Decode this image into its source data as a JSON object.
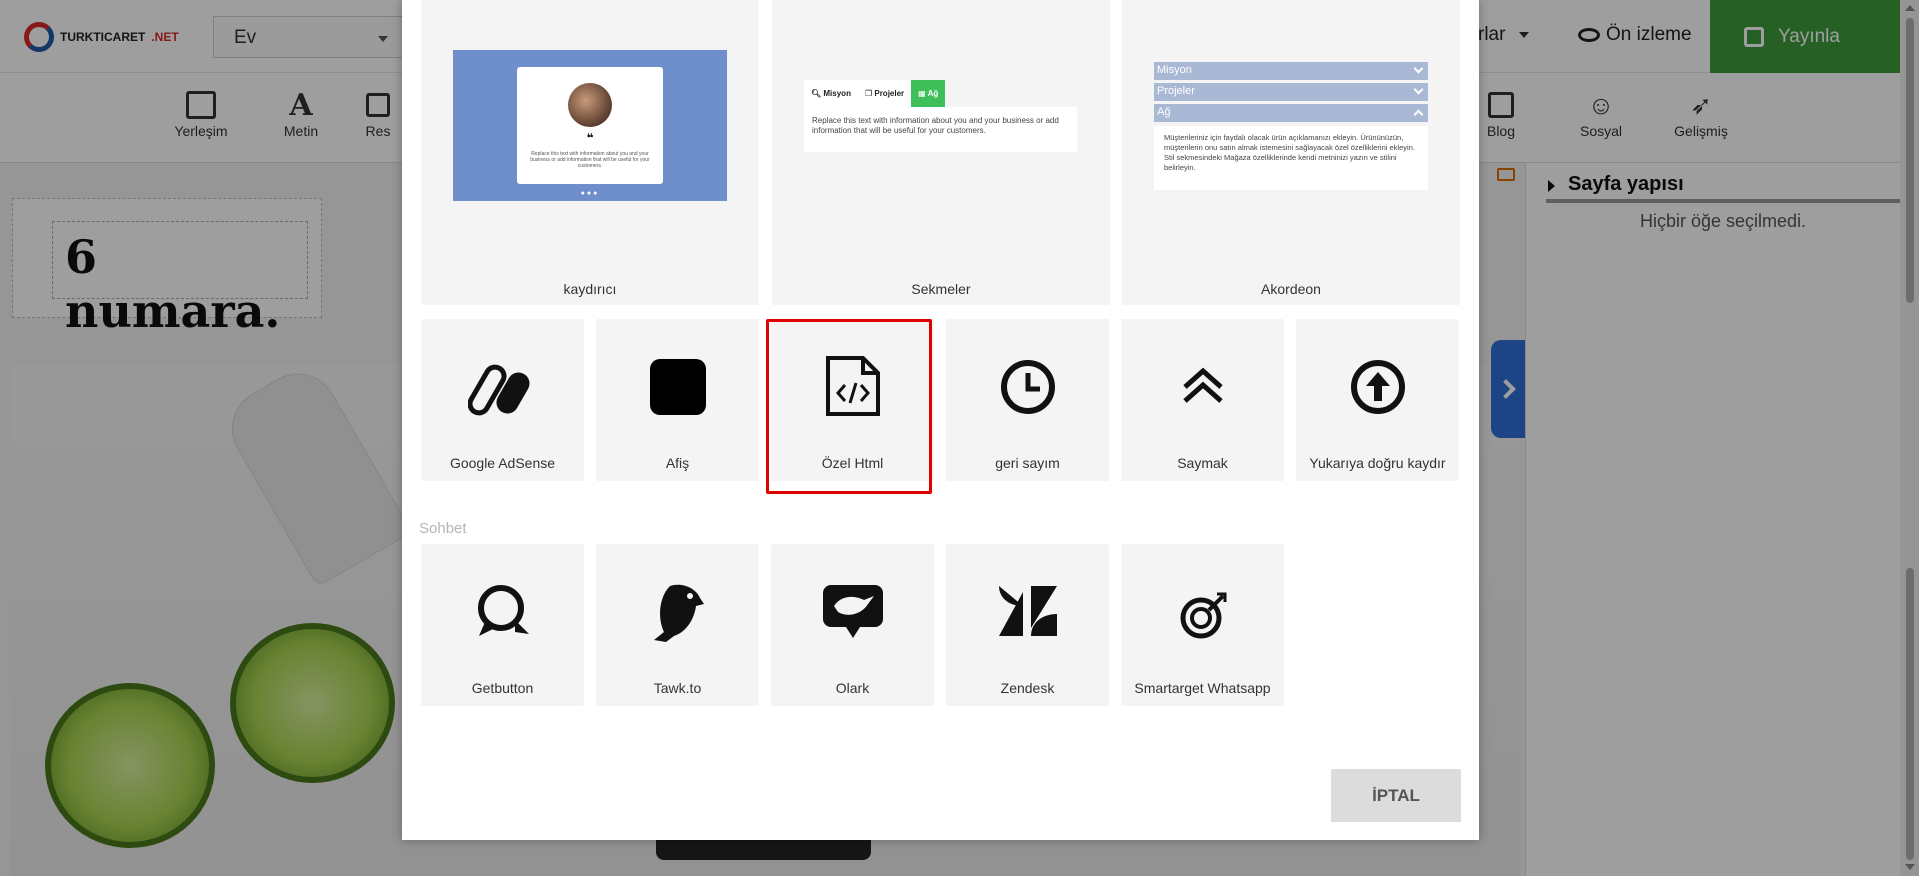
{
  "app": {
    "logo_brand": "TURKTICARET",
    "logo_suffix": ".NET",
    "page_selector_value": "Ev",
    "partial_menu_label": "rlar",
    "preview_label": "Ön izleme",
    "publish_label": "Yayınla"
  },
  "toolbar": {
    "items": [
      {
        "label": "Yerleşim",
        "icon": "layout-icon"
      },
      {
        "label": "Metin",
        "icon": "text-icon"
      },
      {
        "label": "Res",
        "icon": "image-icon"
      },
      {
        "label": "Blog",
        "icon": "blog-edit-icon"
      },
      {
        "label": "Sosyal",
        "icon": "users-icon"
      },
      {
        "label": "Gelişmiş",
        "icon": "rocket-icon"
      }
    ]
  },
  "canvas": {
    "heading_text": "6 numara."
  },
  "right_panel": {
    "title": "Sayfa yapısı",
    "empty_text": "Hiçbir öğe seçilmedi."
  },
  "modal": {
    "top_cards": [
      {
        "label": "kaydırıcı",
        "preview_quote": "❝",
        "preview_text": "Replace this text with information about you and your business or add information that will be useful for your customers."
      },
      {
        "label": "Sekmeler",
        "preview_tabs": [
          "Misyon",
          "Projeler",
          "Ağ"
        ],
        "preview_text": "Replace this text with information about you and your business or add information that will be useful for your customers."
      },
      {
        "label": "Akordeon",
        "preview_rows": [
          "Misyon",
          "Projeler",
          "Ağ"
        ],
        "preview_text": "Müşterileriniz için faydalı olacak ürün açıklamanızı ekleyin. Ürününüzün, müşterilerin onu satın almak istemesini sağlayacak özel özelliklerini ekleyin. Stil sekmesindeki Mağaza özelliklerinde kendi metninizi yazın ve stilini belirleyin."
      }
    ],
    "widgets": [
      {
        "label": "Google AdSense",
        "icon": "adsense-icon"
      },
      {
        "label": "Afiş",
        "icon": "banner-square-icon"
      },
      {
        "label": "Özel Html",
        "icon": "html-file-icon",
        "selected": true
      },
      {
        "label": "geri sayım",
        "icon": "clock-icon"
      },
      {
        "label": "Saymak",
        "icon": "double-chevron-up-icon"
      },
      {
        "label": "Yukarıya doğru kaydır",
        "icon": "arrow-up-circle-icon"
      }
    ],
    "chat_section_title": "Sohbet",
    "chat_widgets": [
      {
        "label": "Getbutton",
        "icon": "getbutton-icon"
      },
      {
        "label": "Tawk.to",
        "icon": "tawkto-parrot-icon"
      },
      {
        "label": "Olark",
        "icon": "olark-bird-icon"
      },
      {
        "label": "Zendesk",
        "icon": "zendesk-icon"
      },
      {
        "label": "Smartarget Whatsapp",
        "icon": "target-dollar-icon"
      }
    ],
    "cancel_label": "İPTAL"
  },
  "colors": {
    "publish_green": "#3e9b3c",
    "selection_red": "#e00000",
    "slider_preview_blue": "#6f8fcc",
    "tab_active_green": "#3fbf5a",
    "side_toggle_blue": "#2f6fd6"
  }
}
